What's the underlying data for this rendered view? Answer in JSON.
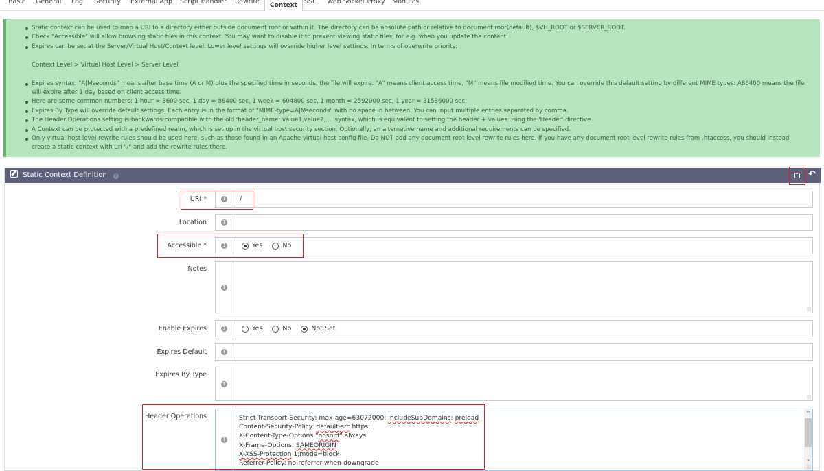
{
  "tabs": [
    {
      "label": "Basic",
      "active": false
    },
    {
      "label": "General",
      "active": false
    },
    {
      "label": "Log",
      "active": false
    },
    {
      "label": "Security",
      "active": false
    },
    {
      "label": "External App",
      "active": false
    },
    {
      "label": "Script Handler",
      "active": false
    },
    {
      "label": "Rewrite",
      "active": false
    },
    {
      "label": "Context",
      "active": true
    },
    {
      "label": "SSL",
      "active": false
    },
    {
      "label": "Web Socket Proxy",
      "active": false
    },
    {
      "label": "Modules",
      "active": false
    }
  ],
  "info": {
    "bullets_top": [
      "Static context can be used to map a URI to a directory either outside document root or within it. The directory can be absolute path or relative to document root(default), $VH_ROOT or $SERVER_ROOT.",
      "Check \"Accessible\" will allow browsing static files in this context. You may want to disable it to prevent viewing static files, for e.g. when you update the content.",
      "Expires can be set at the Server/Virtual Host/Context level. Lower level settings will override higher level settings. In terms of overwrite priority:"
    ],
    "priority_line": "Context Level > Virtual Host Level > Server Level",
    "bullets_bottom": [
      "Expires syntax, \"A|Mseconds\" means after base time (A or M) plus the specified time in seconds, the file will expire. \"A\" means client access time, \"M\" means file modified time. You can override this default setting by different MIME types: A86400 means the file will expire after 1 day based on client access time.",
      "Here are some common numbers: 1 hour = 3600 sec, 1 day = 86400 sec, 1 week = 604800 sec, 1 month = 2592000 sec, 1 year = 31536000 sec.",
      "Expires By Type will override default settings. Each entry is in the format of \"MIME-type=A|Mseconds\" with no space in between. You can input multiple entries separated by comma.",
      "The Header Operations setting is backwards compatible with the old 'header_name: value1,value2,...' syntax, which is equivalent to setting the header + values using the 'Header' directive.",
      "A Context can be protected with a predefined realm, which is set up in the virtual host security section. Optionally, an alternative name and additional requirements can be specified.",
      "Only virtual host level rewrite rules should be used here, such as those found in an Apache virtual host config file. Do NOT add any document root level rewrite rules here. If you have any document root level rewrite rules from .htaccess, you should instead create a static context with uri \"/\" and add the rewrite rules there."
    ]
  },
  "panel": {
    "title": "Static Context Definition",
    "help_glyph": "?",
    "save_icon": "save-icon",
    "back_icon": "undo-icon",
    "back_glyph": "↶"
  },
  "form": {
    "help_glyph": "?",
    "uri": {
      "label": "URI *",
      "value": "/"
    },
    "location": {
      "label": "Location",
      "value": ""
    },
    "accessible": {
      "label": "Accessible *",
      "options": [
        "Yes",
        "No"
      ],
      "selected": "Yes"
    },
    "notes": {
      "label": "Notes",
      "value": ""
    },
    "enable_expires": {
      "label": "Enable Expires",
      "options": [
        "Yes",
        "No",
        "Not Set"
      ],
      "selected": "Not Set"
    },
    "expires_default": {
      "label": "Expires Default",
      "value": ""
    },
    "expires_by_type": {
      "label": "Expires By Type",
      "value": ""
    },
    "header_operations": {
      "label": "Header Operations",
      "lines": [
        "Strict-Transport-Security: max-age=63072000; includeSubDomains; preload",
        "Content-Security-Policy: default-src https:",
        "X-Content-Type-Options \"nosniff\" always",
        "X-Frame-Options: SAMEORIGIN",
        "X-XSS-Protection 1;mode=block",
        "Referrer-Policy: no-referrer-when-downgrade"
      ]
    }
  },
  "colors": {
    "info_bg": "#b6e4bd",
    "info_border": "#59b66a",
    "panel_header": "#5c6079",
    "highlight": "#e02020"
  }
}
